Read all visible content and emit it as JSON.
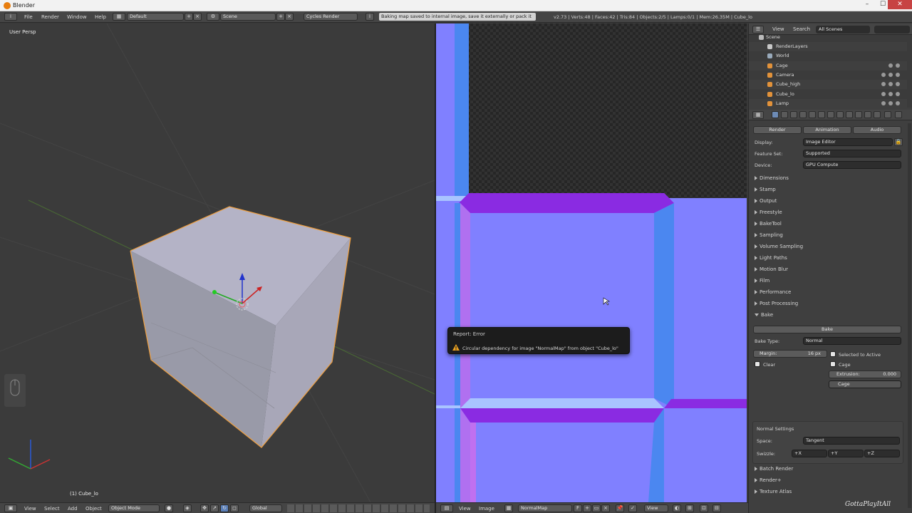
{
  "window": {
    "title": "Blender",
    "controls": {
      "minimize": "–",
      "maximize": "☐",
      "close": "✕"
    }
  },
  "info_header": {
    "editor_icon": "i",
    "menus": [
      "File",
      "Render",
      "Window",
      "Help"
    ],
    "screen_layout": "Default",
    "scene": "Scene",
    "render_engine": "Cycles Render",
    "message": "Baking map saved to internal image, save it externally or pack it",
    "stats": "v2.73 | Verts:48 | Faces:42 | Tris:84 | Objects:2/5 | Lamps:0/1 | Mem:26.35M | Cube_lo"
  },
  "viewport3d": {
    "view_label": "User Persp",
    "object_label": "(1) Cube_lo",
    "header": {
      "menus": [
        "View",
        "Select",
        "Add",
        "Object"
      ],
      "mode": "Object Mode",
      "orientation": "Global"
    }
  },
  "image_editor": {
    "header": {
      "menus": [
        "View",
        "Image"
      ],
      "image_name": "NormalMap",
      "view_dropdown": "View"
    },
    "report": {
      "title": "Report: Error",
      "message": "Circular dependency for image \"NormalMap\" from object \"Cube_lo\""
    }
  },
  "outliner": {
    "menus": [
      "View",
      "Search"
    ],
    "filter": "All Scenes",
    "items": [
      {
        "label": "Scene"
      },
      {
        "label": "RenderLayers"
      },
      {
        "label": "World"
      },
      {
        "label": "Cage"
      },
      {
        "label": "Camera"
      },
      {
        "label": "Cube_high"
      },
      {
        "label": "Cube_lo"
      },
      {
        "label": "Lamp"
      }
    ]
  },
  "properties": {
    "render_buttons": [
      "Render",
      "Animation",
      "Audio"
    ],
    "display_label": "Display:",
    "display_value": "Image Editor",
    "feature_set_label": "Feature Set:",
    "feature_set_value": "Supported",
    "device_label": "Device:",
    "device_value": "GPU Compute",
    "panels_top": [
      "Dimensions",
      "Stamp",
      "Output",
      "Freestyle",
      "BakeTool",
      "Sampling",
      "Volume Sampling",
      "Light Paths",
      "Motion Blur",
      "Film",
      "Performance",
      "Post Processing",
      "Bake"
    ],
    "bake": {
      "button": "Bake",
      "bake_type_label": "Bake Type:",
      "bake_type_value": "Normal",
      "margin": "Margin:",
      "margin_value": "16 px",
      "clear": "Clear",
      "selected_to_active": "Selected to Active",
      "cage": "Cage",
      "extrusion_label": "Extrusion:",
      "extrusion_value": "0.000",
      "cage_object": "Cage"
    },
    "normal_settings": {
      "title": "Normal Settings",
      "space_label": "Space:",
      "space_value": "Tangent",
      "swizzle_label": "Swizzle:",
      "swizzle": [
        "+X",
        "+Y",
        "+Z"
      ]
    },
    "panels_bottom": [
      "Batch Render",
      "Render+",
      "Texture Atlas"
    ]
  },
  "watermark": "GottaPlayItAll",
  "colors": {
    "normal_flat": "#8080ff",
    "normal_bevel_top": "#8a2be2",
    "normal_bevel_right": "#4b87f0",
    "normal_bevel_left": "#b070f0",
    "normal_bevel_bottom": "#a9c4ff",
    "selection_outline": "#f0a040"
  }
}
